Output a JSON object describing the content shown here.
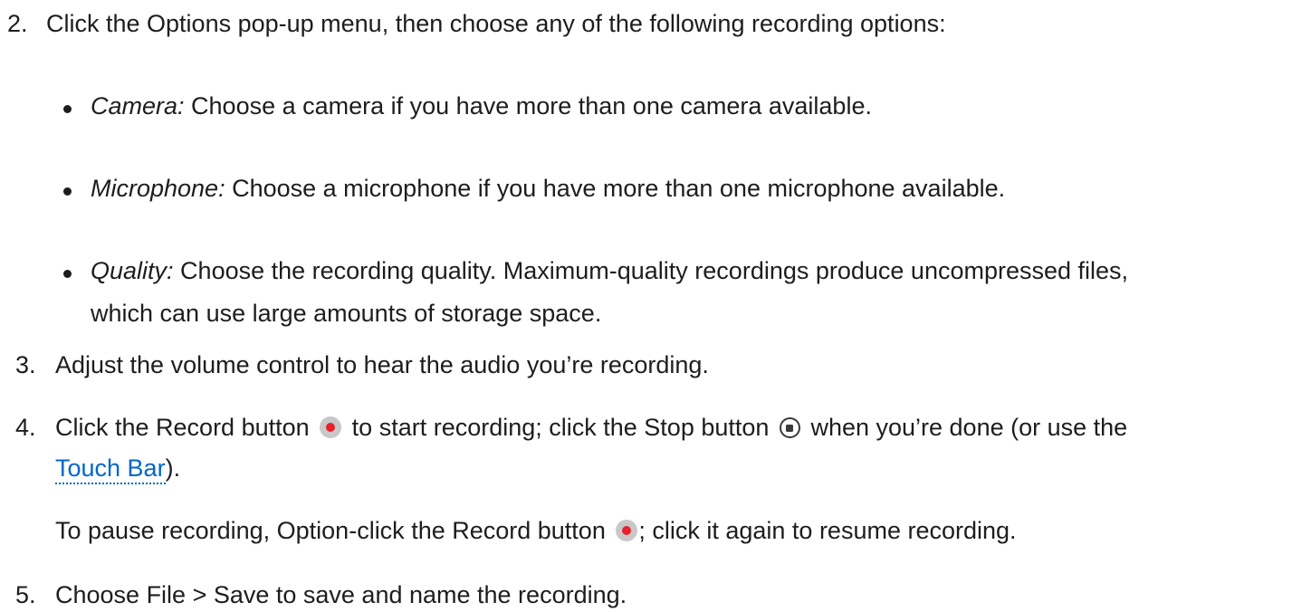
{
  "step2": {
    "number": "2.",
    "text": "Click the Options pop-up menu, then choose any of the following recording options:"
  },
  "options": [
    {
      "term": "Camera:",
      "text": " Choose a camera if you have more than one camera available."
    },
    {
      "term": "Microphone:",
      "text": " Choose a microphone if you have more than one microphone available."
    },
    {
      "term": "Quality:",
      "text": " Choose the recording quality. Maximum-quality recordings produce uncompressed files,",
      "text_line2": "which can use large amounts of storage space."
    }
  ],
  "step3": {
    "number": "3.",
    "text": "Adjust the volume control to hear the audio you’re recording."
  },
  "step4": {
    "number": "4.",
    "text_before_record": "Click the Record button",
    "text_between": "to start recording; click the Stop button",
    "text_after_stop": "when you’re done (or use the",
    "link_text": "Touch Bar",
    "text_end": ").",
    "record_icon": "record-icon",
    "stop_icon": "stop-icon",
    "link_color": "#0066cc",
    "record_color": "#e8202a"
  },
  "step4_note": {
    "text_before": "To pause recording, Option-click the Record button",
    "text_after": "; click it again to resume recording."
  },
  "step5": {
    "number": "5.",
    "text": "Choose File > Save to save and name the recording."
  }
}
